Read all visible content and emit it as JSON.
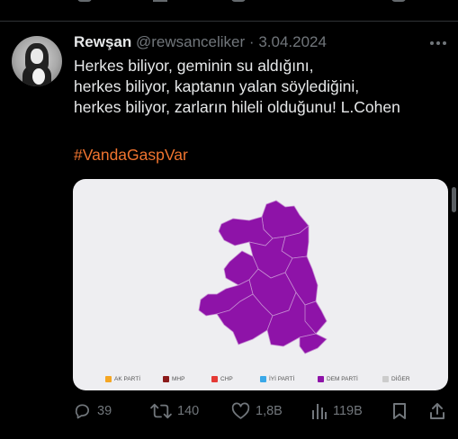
{
  "prev_tweet": {
    "action_counts": [
      "",
      "",
      ""
    ]
  },
  "tweet": {
    "author_name": "Rewşan",
    "handle": "@rewsanceliker",
    "separator": "·",
    "date": "3.04.2024",
    "text_lines": [
      "Herkes biliyor, geminin su aldığını,",
      "herkes biliyor, kaptanın yalan söylediğini,",
      "herkes biliyor, zarların hileli olduğunu! L.Cohen"
    ],
    "hashtag": "#VandaGaspVar"
  },
  "map": {
    "region_color": "#8e13a8",
    "background": "#eeeef1",
    "legend": [
      {
        "label": "AK PARTİ",
        "color": "#f5a623"
      },
      {
        "label": "MHP",
        "color": "#8b1a1a"
      },
      {
        "label": "CHP",
        "color": "#e53935"
      },
      {
        "label": "İYİ PARTİ",
        "color": "#3aa8e8"
      },
      {
        "label": "DEM PARTİ",
        "color": "#8e13a8"
      },
      {
        "label": "DİĞER",
        "color": "#cccccc"
      }
    ]
  },
  "actions": {
    "reply": {
      "icon": "reply-icon",
      "count": "39"
    },
    "repost": {
      "icon": "repost-icon",
      "count": "140"
    },
    "like": {
      "icon": "heart-icon",
      "count": "1,8B"
    },
    "views": {
      "icon": "views-icon",
      "count": "119B"
    },
    "bookmark": {
      "icon": "bookmark-icon"
    },
    "share": {
      "icon": "share-icon"
    }
  }
}
